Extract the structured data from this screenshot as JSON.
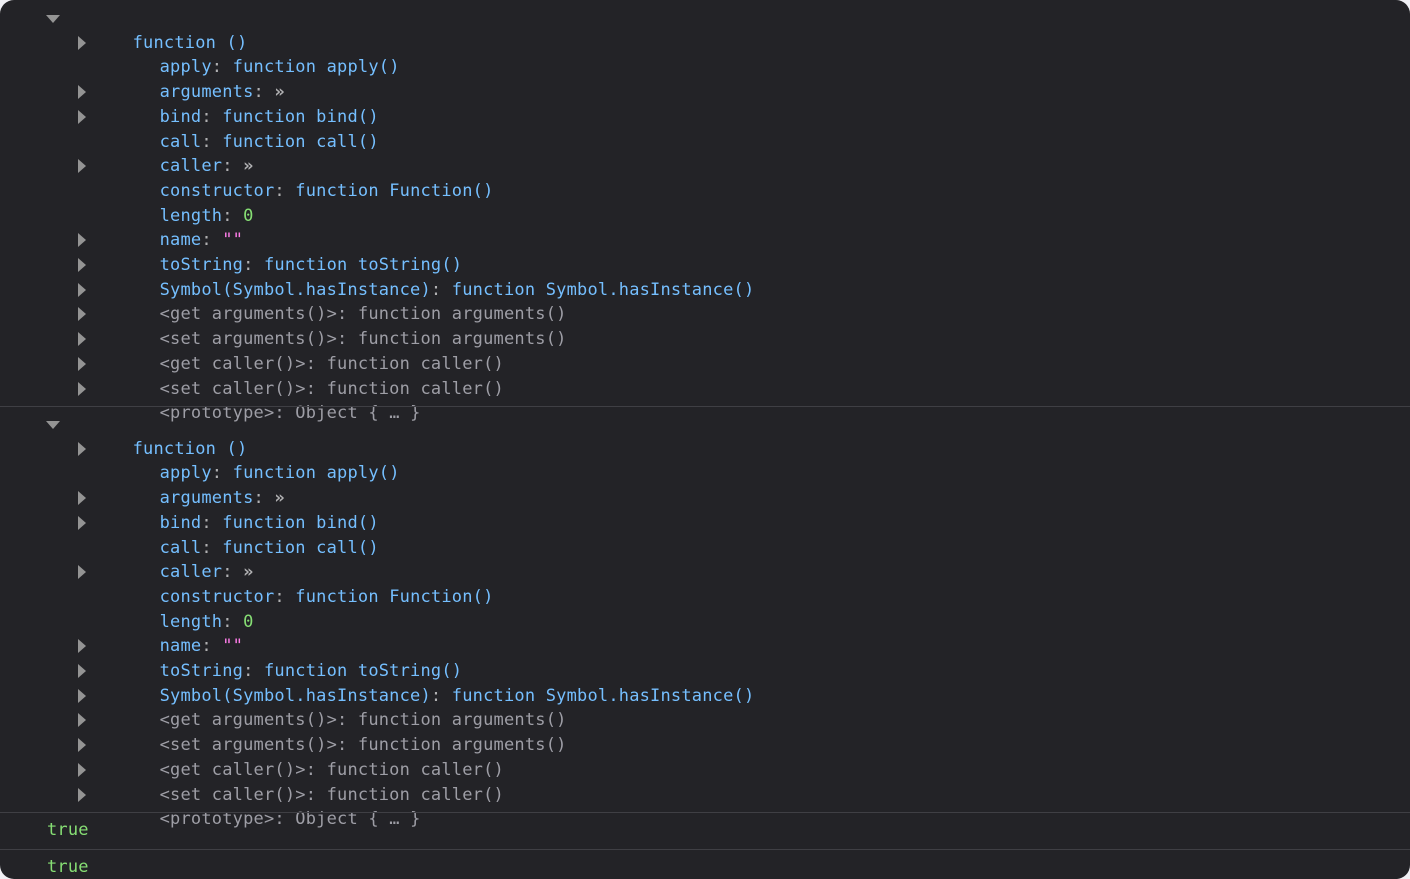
{
  "console": {
    "entries": [
      {
        "header": "function ()",
        "props": [
          {
            "key": "apply",
            "sep": ": ",
            "value": "function apply()",
            "expandable": true,
            "kind": "own"
          },
          {
            "key": "arguments",
            "sep": ": ",
            "value": "»",
            "expandable": false,
            "kind": "lazy"
          },
          {
            "key": "bind",
            "sep": ": ",
            "value": "function bind()",
            "expandable": true,
            "kind": "own"
          },
          {
            "key": "call",
            "sep": ": ",
            "value": "function call()",
            "expandable": true,
            "kind": "own"
          },
          {
            "key": "caller",
            "sep": ": ",
            "value": "»",
            "expandable": false,
            "kind": "lazy"
          },
          {
            "key": "constructor",
            "sep": ": ",
            "value": "function Function()",
            "expandable": true,
            "kind": "own"
          },
          {
            "key": "length",
            "sep": ": ",
            "value": "0",
            "expandable": false,
            "kind": "number"
          },
          {
            "key": "name",
            "sep": ": ",
            "value": "\"\"",
            "expandable": false,
            "kind": "string"
          },
          {
            "key": "toString",
            "sep": ": ",
            "value": "function toString()",
            "expandable": true,
            "kind": "own"
          },
          {
            "key": "Symbol(Symbol.hasInstance)",
            "sep": ": ",
            "value": "function Symbol.hasInstance()",
            "expandable": true,
            "kind": "own"
          },
          {
            "key": "<get arguments()>",
            "sep": ": ",
            "value": "function arguments()",
            "expandable": true,
            "kind": "accessor"
          },
          {
            "key": "<set arguments()>",
            "sep": ": ",
            "value": "function arguments()",
            "expandable": true,
            "kind": "accessor"
          },
          {
            "key": "<get caller()>",
            "sep": ": ",
            "value": "function caller()",
            "expandable": true,
            "kind": "accessor"
          },
          {
            "key": "<set caller()>",
            "sep": ": ",
            "value": "function caller()",
            "expandable": true,
            "kind": "accessor"
          },
          {
            "key": "<prototype>",
            "sep": ": ",
            "value": "Object { … }",
            "expandable": true,
            "kind": "accessor"
          }
        ]
      },
      {
        "header": "function ()",
        "props": [
          {
            "key": "apply",
            "sep": ": ",
            "value": "function apply()",
            "expandable": true,
            "kind": "own"
          },
          {
            "key": "arguments",
            "sep": ": ",
            "value": "»",
            "expandable": false,
            "kind": "lazy"
          },
          {
            "key": "bind",
            "sep": ": ",
            "value": "function bind()",
            "expandable": true,
            "kind": "own"
          },
          {
            "key": "call",
            "sep": ": ",
            "value": "function call()",
            "expandable": true,
            "kind": "own"
          },
          {
            "key": "caller",
            "sep": ": ",
            "value": "»",
            "expandable": false,
            "kind": "lazy"
          },
          {
            "key": "constructor",
            "sep": ": ",
            "value": "function Function()",
            "expandable": true,
            "kind": "own"
          },
          {
            "key": "length",
            "sep": ": ",
            "value": "0",
            "expandable": false,
            "kind": "number"
          },
          {
            "key": "name",
            "sep": ": ",
            "value": "\"\"",
            "expandable": false,
            "kind": "string"
          },
          {
            "key": "toString",
            "sep": ": ",
            "value": "function toString()",
            "expandable": true,
            "kind": "own"
          },
          {
            "key": "Symbol(Symbol.hasInstance)",
            "sep": ": ",
            "value": "function Symbol.hasInstance()",
            "expandable": true,
            "kind": "own"
          },
          {
            "key": "<get arguments()>",
            "sep": ": ",
            "value": "function arguments()",
            "expandable": true,
            "kind": "accessor"
          },
          {
            "key": "<set arguments()>",
            "sep": ": ",
            "value": "function arguments()",
            "expandable": true,
            "kind": "accessor"
          },
          {
            "key": "<get caller()>",
            "sep": ": ",
            "value": "function caller()",
            "expandable": true,
            "kind": "accessor"
          },
          {
            "key": "<set caller()>",
            "sep": ": ",
            "value": "function caller()",
            "expandable": true,
            "kind": "accessor"
          },
          {
            "key": "<prototype>",
            "sep": ": ",
            "value": "Object { … }",
            "expandable": true,
            "kind": "accessor"
          }
        ]
      }
    ],
    "results": [
      "true",
      "true"
    ]
  },
  "colors": {
    "background": "#232327",
    "key": "#75bfff",
    "function": "#75bfff",
    "number": "#86de74",
    "string": "#ff7de9",
    "boolean": "#86de74",
    "dimmed": "#9e9ea6",
    "divider": "#3f3f44"
  }
}
